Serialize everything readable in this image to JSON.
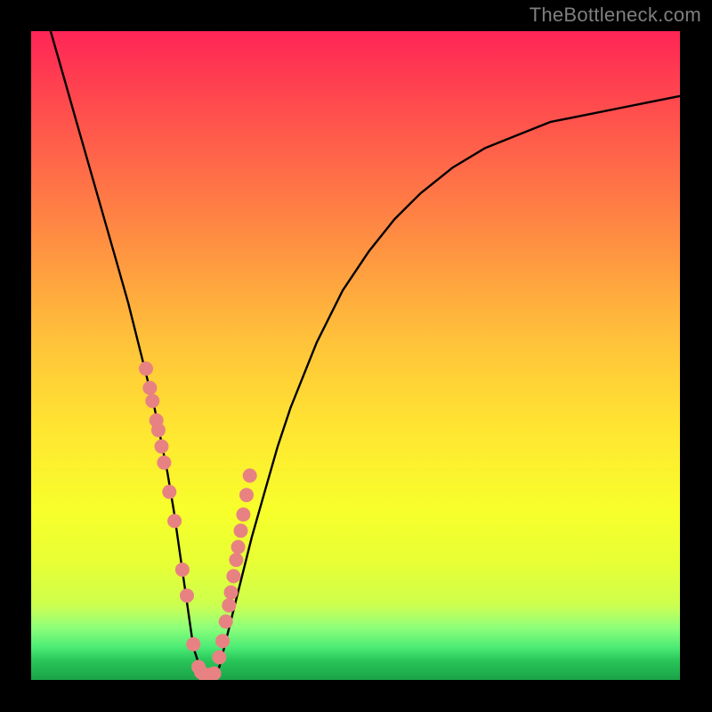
{
  "watermark": "TheBottleneck.com",
  "chart_data": {
    "type": "line",
    "title": "",
    "xlabel": "",
    "ylabel": "",
    "xlim": [
      0,
      100
    ],
    "ylim": [
      0,
      100
    ],
    "x": [
      3,
      5,
      7,
      9,
      11,
      13,
      15,
      17,
      19,
      20,
      21,
      22,
      23,
      24,
      25,
      26,
      27,
      28,
      29,
      30,
      32,
      34,
      36,
      38,
      40,
      44,
      48,
      52,
      56,
      60,
      65,
      70,
      75,
      80,
      85,
      90,
      95,
      100
    ],
    "values": [
      100,
      93,
      86,
      79,
      72,
      65,
      58,
      50,
      42,
      37,
      32,
      26,
      19,
      12,
      5,
      2,
      0,
      0,
      2,
      6,
      14,
      22,
      29,
      36,
      42,
      52,
      60,
      66,
      71,
      75,
      79,
      82,
      84,
      86,
      87,
      88,
      89,
      90
    ],
    "minimum_x": 27,
    "dot_color": "#E88282",
    "dot_points_x": [
      17.7,
      18.3,
      18.7,
      19.3,
      19.6,
      20.1,
      20.5,
      21.3,
      22.1,
      23.3,
      24.0,
      25.0,
      25.8,
      26.2,
      26.6,
      27.5,
      28.2,
      29.0,
      29.5,
      30.0,
      30.5,
      30.8,
      31.2,
      31.6,
      31.9,
      32.3,
      32.7,
      33.2,
      33.7
    ],
    "dot_points_y": [
      48.0,
      45.0,
      43.0,
      40.0,
      38.5,
      36.0,
      33.5,
      29.0,
      24.5,
      17.0,
      13.0,
      5.5,
      2.0,
      1.2,
      0.9,
      0.8,
      1.0,
      3.5,
      6.0,
      9.0,
      11.5,
      13.5,
      16.0,
      18.5,
      20.5,
      23.0,
      25.5,
      28.5,
      31.5
    ]
  }
}
